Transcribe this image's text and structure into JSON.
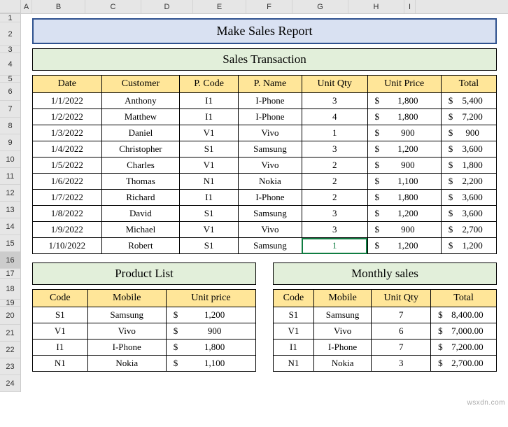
{
  "columns": [
    "A",
    "B",
    "C",
    "D",
    "E",
    "F",
    "G",
    "H",
    "I"
  ],
  "rows": [
    "1",
    "2",
    "3",
    "4",
    "5",
    "6",
    "7",
    "8",
    "9",
    "10",
    "11",
    "12",
    "13",
    "14",
    "15",
    "16",
    "17",
    "18",
    "19",
    "20",
    "21",
    "22",
    "23",
    "24"
  ],
  "activeRow": "16",
  "title": "Make Sales Report",
  "section1": "Sales Transaction",
  "transHeaders": [
    "Date",
    "Customer",
    "P. Code",
    "P. Name",
    "Unit Qty",
    "Unit Price",
    "Total"
  ],
  "transactions": [
    {
      "date": "1/1/2022",
      "customer": "Anthony",
      "pcode": "I1",
      "pname": "I-Phone",
      "qty": "3",
      "price": "1,800",
      "total": "5,400"
    },
    {
      "date": "1/2/2022",
      "customer": "Matthew",
      "pcode": "I1",
      "pname": "I-Phone",
      "qty": "4",
      "price": "1,800",
      "total": "7,200"
    },
    {
      "date": "1/3/2022",
      "customer": "Daniel",
      "pcode": "V1",
      "pname": "Vivo",
      "qty": "1",
      "price": "900",
      "total": "900"
    },
    {
      "date": "1/4/2022",
      "customer": "Christopher",
      "pcode": "S1",
      "pname": "Samsung",
      "qty": "3",
      "price": "1,200",
      "total": "3,600"
    },
    {
      "date": "1/5/2022",
      "customer": "Charles",
      "pcode": "V1",
      "pname": "Vivo",
      "qty": "2",
      "price": "900",
      "total": "1,800"
    },
    {
      "date": "1/6/2022",
      "customer": "Thomas",
      "pcode": "N1",
      "pname": "Nokia",
      "qty": "2",
      "price": "1,100",
      "total": "2,200"
    },
    {
      "date": "1/7/2022",
      "customer": "Richard",
      "pcode": "I1",
      "pname": "I-Phone",
      "qty": "2",
      "price": "1,800",
      "total": "3,600"
    },
    {
      "date": "1/8/2022",
      "customer": "David",
      "pcode": "S1",
      "pname": "Samsung",
      "qty": "3",
      "price": "1,200",
      "total": "3,600"
    },
    {
      "date": "1/9/2022",
      "customer": "Michael",
      "pcode": "V1",
      "pname": "Vivo",
      "qty": "3",
      "price": "900",
      "total": "2,700"
    },
    {
      "date": "1/10/2022",
      "customer": "Robert",
      "pcode": "S1",
      "pname": "Samsung",
      "qty": "1",
      "price": "1,200",
      "total": "1,200"
    }
  ],
  "section2": "Product List",
  "prodHeaders": [
    "Code",
    "Mobile",
    "Unit price"
  ],
  "products": [
    {
      "code": "S1",
      "mobile": "Samsung",
      "price": "1,200"
    },
    {
      "code": "V1",
      "mobile": "Vivo",
      "price": "900"
    },
    {
      "code": "I1",
      "mobile": "I-Phone",
      "price": "1,800"
    },
    {
      "code": "N1",
      "mobile": "Nokia",
      "price": "1,100"
    }
  ],
  "section3": "Monthly sales",
  "monthHeaders": [
    "Code",
    "Mobile",
    "Unit Qty",
    "Total"
  ],
  "monthly": [
    {
      "code": "S1",
      "mobile": "Samsung",
      "qty": "7",
      "total": "8,400.00"
    },
    {
      "code": "V1",
      "mobile": "Vivo",
      "qty": "6",
      "total": "7,000.00"
    },
    {
      "code": "I1",
      "mobile": "I-Phone",
      "qty": "7",
      "total": "7,200.00"
    },
    {
      "code": "N1",
      "mobile": "Nokia",
      "qty": "3",
      "total": "2,700.00"
    }
  ],
  "watermark": "wsxdn.com"
}
